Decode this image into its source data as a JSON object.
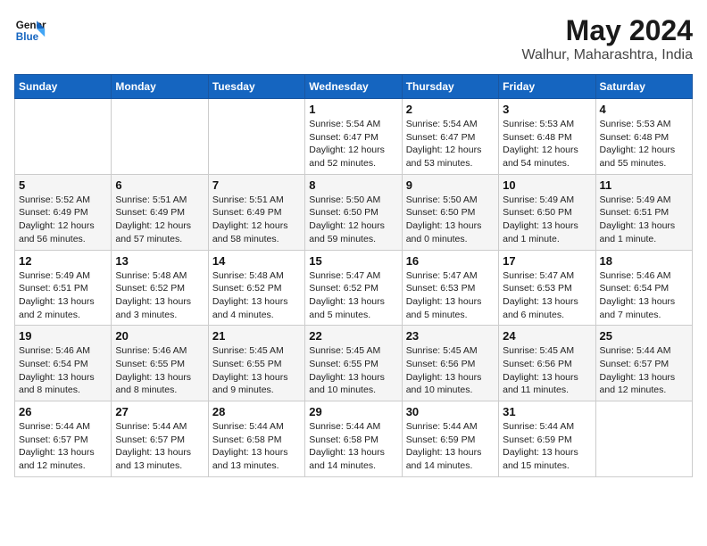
{
  "header": {
    "logo_line1": "General",
    "logo_line2": "Blue",
    "main_title": "May 2024",
    "subtitle": "Walhur, Maharashtra, India"
  },
  "days_of_week": [
    "Sunday",
    "Monday",
    "Tuesday",
    "Wednesday",
    "Thursday",
    "Friday",
    "Saturday"
  ],
  "weeks": [
    [
      {
        "day": "",
        "info": ""
      },
      {
        "day": "",
        "info": ""
      },
      {
        "day": "",
        "info": ""
      },
      {
        "day": "1",
        "info": "Sunrise: 5:54 AM\nSunset: 6:47 PM\nDaylight: 12 hours\nand 52 minutes."
      },
      {
        "day": "2",
        "info": "Sunrise: 5:54 AM\nSunset: 6:47 PM\nDaylight: 12 hours\nand 53 minutes."
      },
      {
        "day": "3",
        "info": "Sunrise: 5:53 AM\nSunset: 6:48 PM\nDaylight: 12 hours\nand 54 minutes."
      },
      {
        "day": "4",
        "info": "Sunrise: 5:53 AM\nSunset: 6:48 PM\nDaylight: 12 hours\nand 55 minutes."
      }
    ],
    [
      {
        "day": "5",
        "info": "Sunrise: 5:52 AM\nSunset: 6:49 PM\nDaylight: 12 hours\nand 56 minutes."
      },
      {
        "day": "6",
        "info": "Sunrise: 5:51 AM\nSunset: 6:49 PM\nDaylight: 12 hours\nand 57 minutes."
      },
      {
        "day": "7",
        "info": "Sunrise: 5:51 AM\nSunset: 6:49 PM\nDaylight: 12 hours\nand 58 minutes."
      },
      {
        "day": "8",
        "info": "Sunrise: 5:50 AM\nSunset: 6:50 PM\nDaylight: 12 hours\nand 59 minutes."
      },
      {
        "day": "9",
        "info": "Sunrise: 5:50 AM\nSunset: 6:50 PM\nDaylight: 13 hours\nand 0 minutes."
      },
      {
        "day": "10",
        "info": "Sunrise: 5:49 AM\nSunset: 6:50 PM\nDaylight: 13 hours\nand 1 minute."
      },
      {
        "day": "11",
        "info": "Sunrise: 5:49 AM\nSunset: 6:51 PM\nDaylight: 13 hours\nand 1 minute."
      }
    ],
    [
      {
        "day": "12",
        "info": "Sunrise: 5:49 AM\nSunset: 6:51 PM\nDaylight: 13 hours\nand 2 minutes."
      },
      {
        "day": "13",
        "info": "Sunrise: 5:48 AM\nSunset: 6:52 PM\nDaylight: 13 hours\nand 3 minutes."
      },
      {
        "day": "14",
        "info": "Sunrise: 5:48 AM\nSunset: 6:52 PM\nDaylight: 13 hours\nand 4 minutes."
      },
      {
        "day": "15",
        "info": "Sunrise: 5:47 AM\nSunset: 6:52 PM\nDaylight: 13 hours\nand 5 minutes."
      },
      {
        "day": "16",
        "info": "Sunrise: 5:47 AM\nSunset: 6:53 PM\nDaylight: 13 hours\nand 5 minutes."
      },
      {
        "day": "17",
        "info": "Sunrise: 5:47 AM\nSunset: 6:53 PM\nDaylight: 13 hours\nand 6 minutes."
      },
      {
        "day": "18",
        "info": "Sunrise: 5:46 AM\nSunset: 6:54 PM\nDaylight: 13 hours\nand 7 minutes."
      }
    ],
    [
      {
        "day": "19",
        "info": "Sunrise: 5:46 AM\nSunset: 6:54 PM\nDaylight: 13 hours\nand 8 minutes."
      },
      {
        "day": "20",
        "info": "Sunrise: 5:46 AM\nSunset: 6:55 PM\nDaylight: 13 hours\nand 8 minutes."
      },
      {
        "day": "21",
        "info": "Sunrise: 5:45 AM\nSunset: 6:55 PM\nDaylight: 13 hours\nand 9 minutes."
      },
      {
        "day": "22",
        "info": "Sunrise: 5:45 AM\nSunset: 6:55 PM\nDaylight: 13 hours\nand 10 minutes."
      },
      {
        "day": "23",
        "info": "Sunrise: 5:45 AM\nSunset: 6:56 PM\nDaylight: 13 hours\nand 10 minutes."
      },
      {
        "day": "24",
        "info": "Sunrise: 5:45 AM\nSunset: 6:56 PM\nDaylight: 13 hours\nand 11 minutes."
      },
      {
        "day": "25",
        "info": "Sunrise: 5:44 AM\nSunset: 6:57 PM\nDaylight: 13 hours\nand 12 minutes."
      }
    ],
    [
      {
        "day": "26",
        "info": "Sunrise: 5:44 AM\nSunset: 6:57 PM\nDaylight: 13 hours\nand 12 minutes."
      },
      {
        "day": "27",
        "info": "Sunrise: 5:44 AM\nSunset: 6:57 PM\nDaylight: 13 hours\nand 13 minutes."
      },
      {
        "day": "28",
        "info": "Sunrise: 5:44 AM\nSunset: 6:58 PM\nDaylight: 13 hours\nand 13 minutes."
      },
      {
        "day": "29",
        "info": "Sunrise: 5:44 AM\nSunset: 6:58 PM\nDaylight: 13 hours\nand 14 minutes."
      },
      {
        "day": "30",
        "info": "Sunrise: 5:44 AM\nSunset: 6:59 PM\nDaylight: 13 hours\nand 14 minutes."
      },
      {
        "day": "31",
        "info": "Sunrise: 5:44 AM\nSunset: 6:59 PM\nDaylight: 13 hours\nand 15 minutes."
      },
      {
        "day": "",
        "info": ""
      }
    ]
  ]
}
